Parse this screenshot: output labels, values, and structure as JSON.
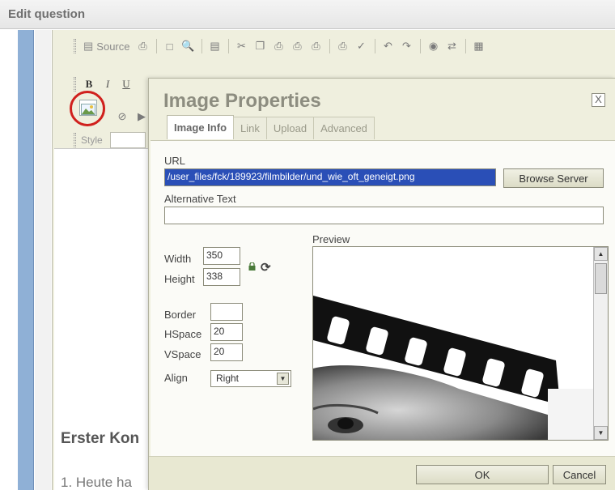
{
  "page": {
    "title": "Edit question"
  },
  "toolbar": {
    "source_label": "Source",
    "style_label": "Style",
    "bold_label": "B",
    "italic_label": "I",
    "underline_label": "U"
  },
  "document": {
    "heading": "Erster Kon",
    "line1": "1. Heute ha"
  },
  "dialog": {
    "title": "Image Properties",
    "close_label": "X",
    "tabs": [
      {
        "label": "Image Info",
        "active": true
      },
      {
        "label": "Link",
        "active": false
      },
      {
        "label": "Upload",
        "active": false
      },
      {
        "label": "Advanced",
        "active": false
      }
    ],
    "url_label": "URL",
    "url_value": "/user_files/fck/189923/filmbilder/und_wie_oft_geneigt.png",
    "browse_label": "Browse Server",
    "alt_label": "Alternative Text",
    "alt_value": "",
    "width_label": "Width",
    "width_value": "350",
    "height_label": "Height",
    "height_value": "338",
    "border_label": "Border",
    "border_value": "",
    "hspace_label": "HSpace",
    "hspace_value": "20",
    "vspace_label": "VSpace",
    "vspace_value": "20",
    "align_label": "Align",
    "align_value": "Right",
    "preview_label": "Preview",
    "ok_label": "OK",
    "cancel_label": "Cancel"
  },
  "colors": {
    "accent_highlight": "#d0201d",
    "selection": "#2a4fb7",
    "dialog_bg": "#efefde"
  }
}
